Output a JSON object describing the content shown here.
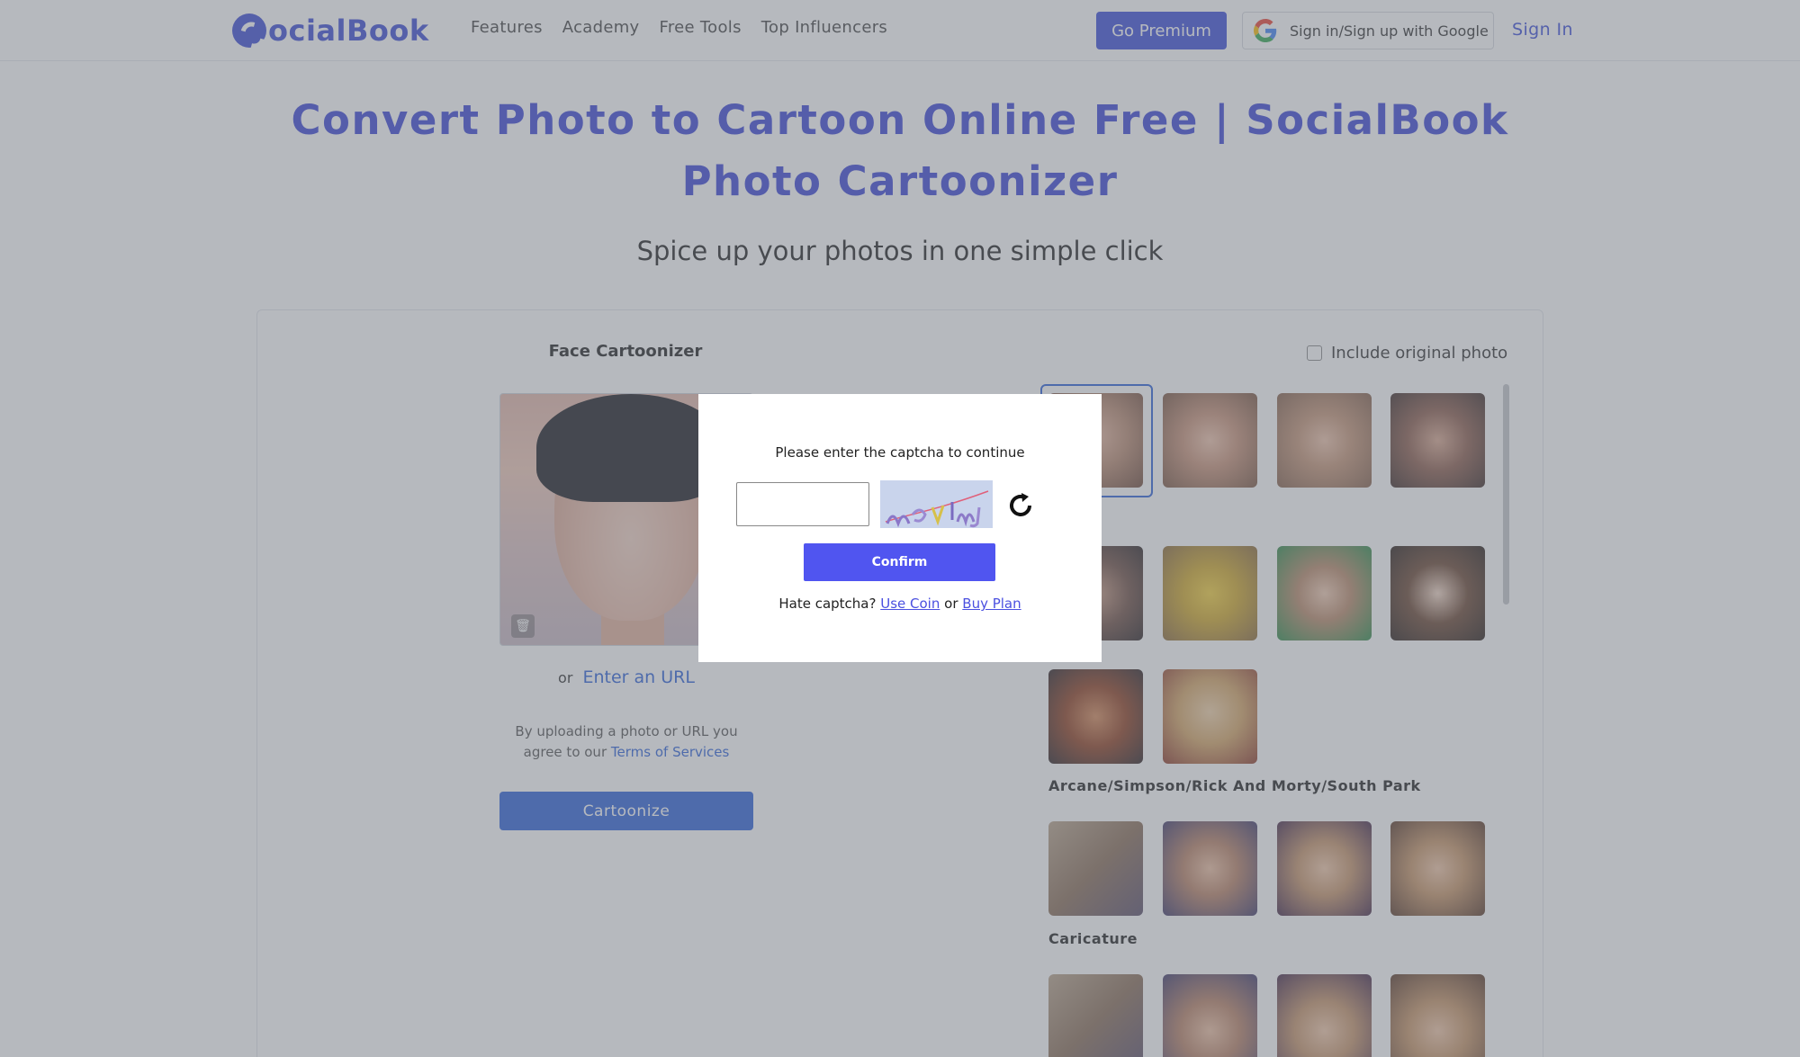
{
  "header": {
    "logo_text": "ocialBook",
    "nav": [
      "Features",
      "Academy",
      "Free Tools",
      "Top Influencers"
    ],
    "go_premium": "Go Premium",
    "google_signin": "Sign in/Sign up with Google",
    "sign_in": "Sign In"
  },
  "hero": {
    "title": "Convert Photo to Cartoon Online Free | SocialBook Photo Cartoonizer",
    "subtitle": "Spice up your photos in one simple click"
  },
  "tool": {
    "card_title": "Face Cartoonizer",
    "include_original": "Include original photo",
    "or_text": "or",
    "enter_url": "Enter an URL",
    "terms_prefix": "By uploading a photo or URL you agree to our",
    "terms_link": "Terms of Services",
    "cartoonize_button": "Cartoonize"
  },
  "styles": {
    "section_labels": [
      "Arcane/Simpson/Rick And Morty/South Park",
      "Caricature"
    ]
  },
  "captcha": {
    "message": "Please enter the captcha to continue",
    "input_value": "",
    "confirm": "Confirm",
    "hate_text": "Hate captcha?",
    "use_coin": "Use Coin",
    "or": "or",
    "buy_plan": "Buy Plan"
  },
  "colors": {
    "brand": "#3c46d6",
    "link": "#2f63d9",
    "confirm": "#5055f0"
  }
}
